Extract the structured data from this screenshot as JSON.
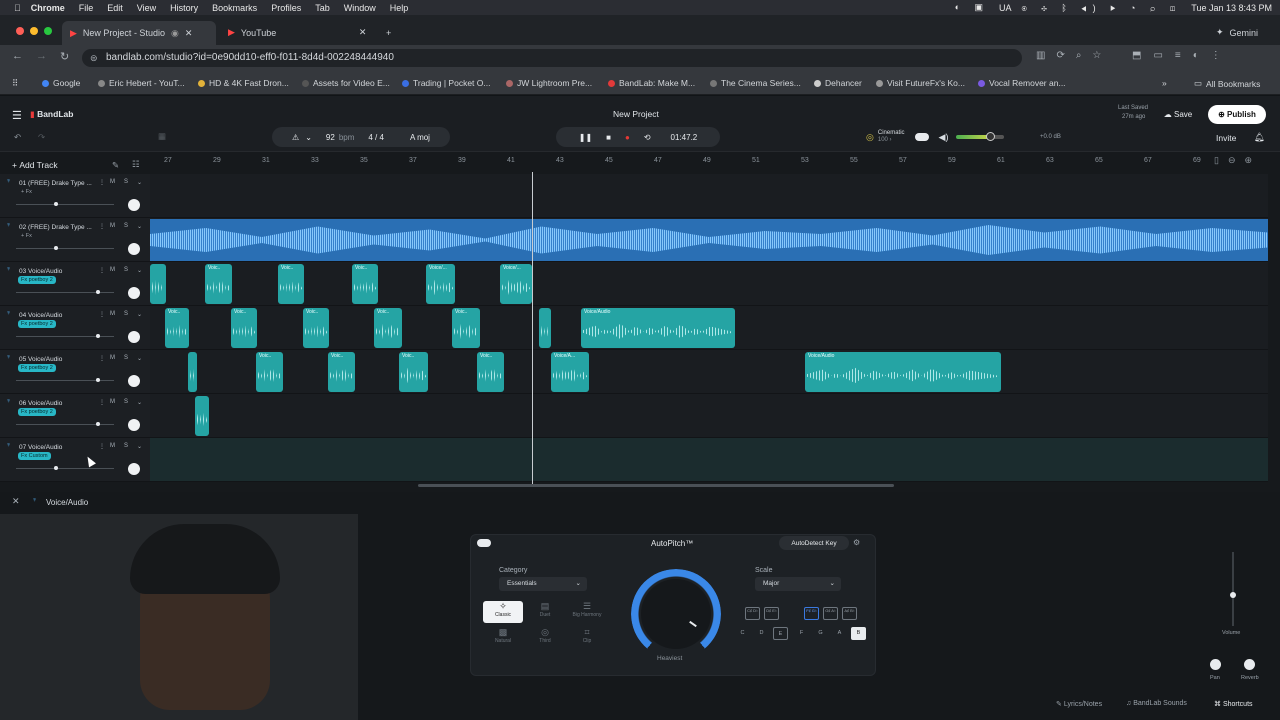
{
  "menubar": {
    "app": "Chrome",
    "items": [
      "File",
      "Edit",
      "View",
      "History",
      "Bookmarks",
      "Profiles",
      "Tab",
      "Window",
      "Help"
    ],
    "locale": "UA",
    "datetime": "Tue Jan 13  8:43 PM"
  },
  "tabs": [
    {
      "label": "New Project - Studio",
      "active": true
    },
    {
      "label": "YouTube",
      "active": false
    }
  ],
  "gemini_label": "Gemini",
  "address": "bandlab.com/studio?id=0e90dd10-eff0-f011-8d4d-002248444940",
  "bookmarks": [
    "Google",
    "Eric Hebert - YouT...",
    "HD & 4K Fast Dron...",
    "Assets for Video E...",
    "Trading | Pocket O...",
    "JW Lightroom Pre...",
    "BandLab: Make M...",
    "The Cinema Series...",
    "Dehancer",
    "Visit FutureFx's Ko...",
    "Vocal Remover an..."
  ],
  "all_bookmarks": "All Bookmarks",
  "studio": {
    "brand": "BandLab",
    "project_title": "New Project",
    "last_saved": "Last Saved",
    "last_saved_ago": "27m ago",
    "save_label": "Save",
    "publish_label": "Publish",
    "invite_label": "Invite",
    "bpm_value": "92",
    "bpm_unit": "bpm",
    "time_sig": "4 / 4",
    "key": "A moj",
    "time": "01:47.2",
    "preset_name": "Cinematic",
    "preset_val": "100 ›",
    "volume_db": "+0.0 dB",
    "add_track": "Add Track",
    "ruler": [
      "27",
      "29",
      "31",
      "33",
      "35",
      "37",
      "39",
      "41",
      "43",
      "45",
      "47",
      "49",
      "51",
      "53",
      "55",
      "57",
      "59",
      "61",
      "63",
      "65",
      "67",
      "69"
    ],
    "tracks": [
      {
        "name": "01  (FREE) Drake Type ...",
        "fx": "+ Fx",
        "teal": false
      },
      {
        "name": "02  (FREE) Drake Type ...",
        "fx": "+ Fx",
        "teal": false
      },
      {
        "name": "03  Voice/Audio",
        "fx": "Fx  poetboy 2",
        "teal": true
      },
      {
        "name": "04  Voice/Audio",
        "fx": "Fx  poetboy 2",
        "teal": true
      },
      {
        "name": "05  Voice/Audio",
        "fx": "Fx  poetboy 2",
        "teal": true
      },
      {
        "name": "06  Voice/Audio",
        "fx": "Fx  poetboy 2",
        "teal": true
      },
      {
        "name": "07  Voice/Audio",
        "fx": "Fx  Custom",
        "teal": true
      }
    ],
    "mute": "M",
    "solo": "S",
    "clip_label": "Voice/Audio",
    "clip_short": "Voic..",
    "clip_short2": "Voice/...",
    "clip_short3": "Voice/A..."
  },
  "bottom": {
    "track_label": "Voice/Audio",
    "plugin_title": "AutoPitch™",
    "autodetect": "AutoDetect Key",
    "category_label": "Category",
    "category_value": "Essentials",
    "scale_label": "Scale",
    "scale_value": "Major",
    "presets": [
      "Classic",
      "Duet",
      "Big Harmony",
      "Natural",
      "Third",
      "Clip"
    ],
    "knob_label": "Heaviest",
    "sharp_keys": [
      "C♯ D♭",
      "D♯ E♭",
      "F♯ G♭",
      "G♯ A♭",
      "A♯ B♭"
    ],
    "keys": [
      "C",
      "D",
      "E",
      "F",
      "G",
      "A",
      "B"
    ],
    "volume_label": "Volume",
    "pan_label": "Pan",
    "reverb_label": "Reverb",
    "footer": [
      "Lyrics/Notes",
      "BandLab Sounds",
      "Shortcuts"
    ]
  }
}
